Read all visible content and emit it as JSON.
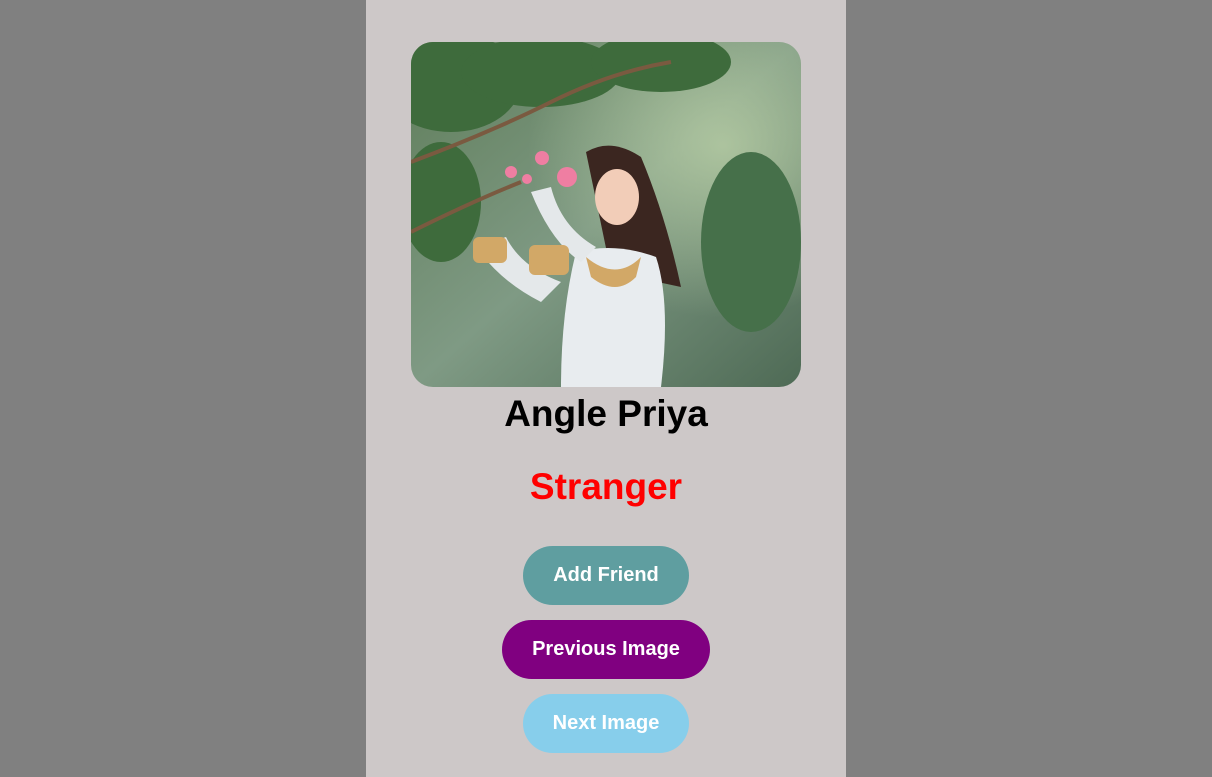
{
  "profile": {
    "name": "Angle Priya",
    "status": "Stranger",
    "status_color": "#ff0000"
  },
  "buttons": {
    "add_friend": "Add Friend",
    "previous_image": "Previous Image",
    "next_image": "Next Image"
  },
  "colors": {
    "page_background": "#808080",
    "card_background": "#cdc8c8",
    "add_friend_button": "#5f9ea0",
    "previous_image_button": "#800080",
    "next_image_button": "#87ceeb"
  }
}
